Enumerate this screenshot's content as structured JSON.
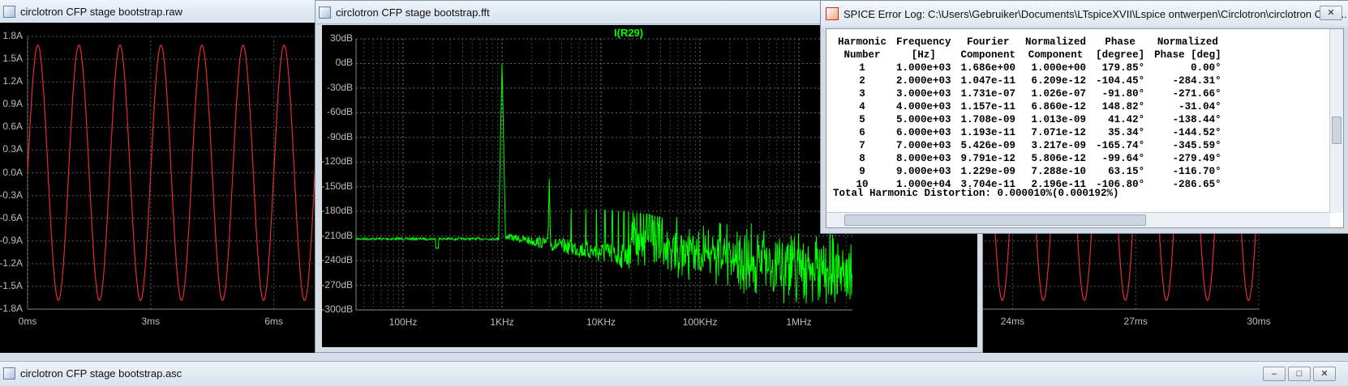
{
  "windows": {
    "raw": {
      "title": "circlotron CFP stage bootstrap.raw",
      "y_ticks": [
        "1.8A",
        "1.5A",
        "1.2A",
        "0.9A",
        "0.6A",
        "0.3A",
        "0.0A",
        "-0.3A",
        "-0.6A",
        "-0.9A",
        "-1.2A",
        "-1.5A",
        "-1.8A"
      ],
      "x_ticks_left": [
        "0ms",
        "3ms",
        "6ms"
      ],
      "x_ticks_right": [
        "24ms",
        "27ms",
        "30ms"
      ],
      "trace_color": "#e0302a"
    },
    "fft": {
      "title": "circlotron CFP stage bootstrap.fft",
      "trace_label": "I(R29)",
      "trace_color": "#00ff00",
      "y_ticks": [
        "30dB",
        "0dB",
        "-30dB",
        "-60dB",
        "-90dB",
        "-120dB",
        "-150dB",
        "-180dB",
        "-210dB",
        "-240dB",
        "-270dB",
        "-300dB"
      ],
      "x_ticks": [
        "100Hz",
        "1KHz",
        "10KHz",
        "100KHz",
        "1MHz"
      ]
    },
    "error_log": {
      "title": "SPICE Error Log: C:\\Users\\Gebruiker\\Documents\\LTspiceXVII\\Lspice ontwerpen\\Circlotron\\circlotron CFP ...",
      "headers": {
        "c1": [
          "Harmonic",
          "Number"
        ],
        "c2": [
          "Frequency",
          "[Hz]"
        ],
        "c3": [
          "Fourier",
          "Component"
        ],
        "c4": [
          "Normalized",
          "Component"
        ],
        "c5": [
          "Phase",
          "[degree]"
        ],
        "c6": [
          "Normalized",
          "Phase [deg]"
        ]
      },
      "rows": [
        [
          "1",
          "1.000e+03",
          "1.686e+00",
          "1.000e+00",
          "179.85°",
          "0.00°"
        ],
        [
          "2",
          "2.000e+03",
          "1.047e-11",
          "6.209e-12",
          "-104.45°",
          "-284.31°"
        ],
        [
          "3",
          "3.000e+03",
          "1.731e-07",
          "1.026e-07",
          "-91.80°",
          "-271.66°"
        ],
        [
          "4",
          "4.000e+03",
          "1.157e-11",
          "6.860e-12",
          "148.82°",
          "-31.04°"
        ],
        [
          "5",
          "5.000e+03",
          "1.708e-09",
          "1.013e-09",
          "41.42°",
          "-138.44°"
        ],
        [
          "6",
          "6.000e+03",
          "1.193e-11",
          "7.071e-12",
          "35.34°",
          "-144.52°"
        ],
        [
          "7",
          "7.000e+03",
          "5.426e-09",
          "3.217e-09",
          "-165.74°",
          "-345.59°"
        ],
        [
          "8",
          "8.000e+03",
          "9.791e-12",
          "5.806e-12",
          "-99.64°",
          "-279.49°"
        ],
        [
          "9",
          "9.000e+03",
          "1.229e-09",
          "7.288e-10",
          "63.15°",
          "-116.70°"
        ],
        [
          "10",
          "1.000e+04",
          "3.704e-11",
          "2.196e-11",
          "-106.80°",
          "-286.65°"
        ]
      ],
      "thd": "Total Harmonic Distortion: 0.000010%(0.000192%)"
    },
    "schematic": {
      "title": "circlotron CFP stage bootstrap.asc"
    }
  }
}
